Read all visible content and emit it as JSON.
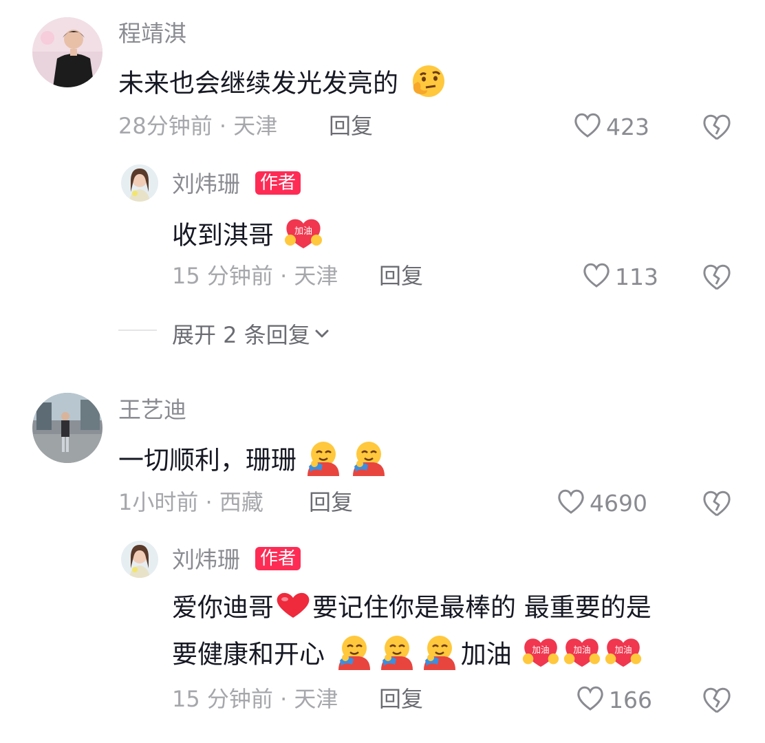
{
  "comments": [
    {
      "user": "程靖淇",
      "text": "未来也会继续发光发亮的",
      "time_location": "28分钟前 · 天津",
      "reply_label": "回复",
      "likes": "423",
      "emoji": "thinking-face",
      "replies": [
        {
          "user": "刘炜珊",
          "badge": "作者",
          "text": "收到淇哥",
          "emoji": "heart-cheer-加油",
          "time_location": "15 分钟前 · 天津",
          "reply_label": "回复",
          "likes": "113"
        }
      ],
      "expand_label": "展开 2 条回复"
    },
    {
      "user": "王艺迪",
      "text": "一切顺利，珊珊",
      "emoji": "hugging-face",
      "time_location": "1小时前 · 西藏",
      "reply_label": "回复",
      "likes": "4690",
      "replies": [
        {
          "user": "刘炜珊",
          "badge": "作者",
          "text_line1_a": "爱你迪哥",
          "text_line1_b": "要记住你是最棒的 最重要的是",
          "text_line2_a": "要健康和开心",
          "text_line2_b": "加油",
          "emoji_badge_text": "加油",
          "time_location": "15 分钟前 · 天津",
          "reply_label": "回复",
          "likes": "166"
        }
      ]
    }
  ],
  "colors": {
    "accent": "#fe2c55",
    "text": "#161823",
    "muted": "#a6a7ab"
  }
}
